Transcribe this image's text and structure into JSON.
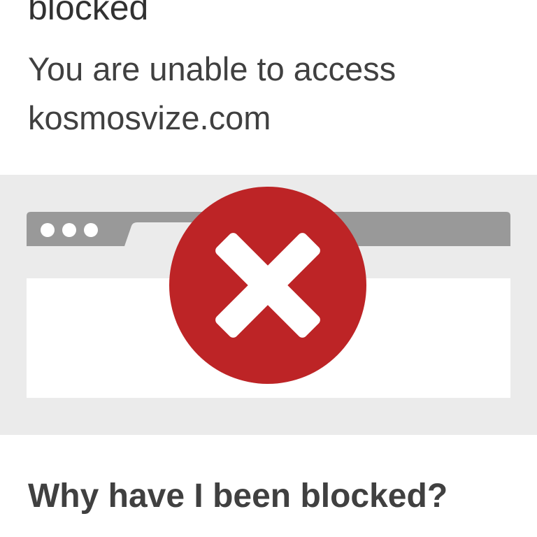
{
  "header": {
    "title": "blocked",
    "message_line1": "You are unable to access",
    "message_line2": "kosmosvize.com"
  },
  "illustration": {
    "icon": "blocked-x-icon",
    "window_dots_icon": "window-controls-icon",
    "accent_color": "#bd2426",
    "chrome_color": "#999999",
    "band_color": "#ebebeb"
  },
  "details": {
    "heading": "Why have I been blocked?"
  }
}
